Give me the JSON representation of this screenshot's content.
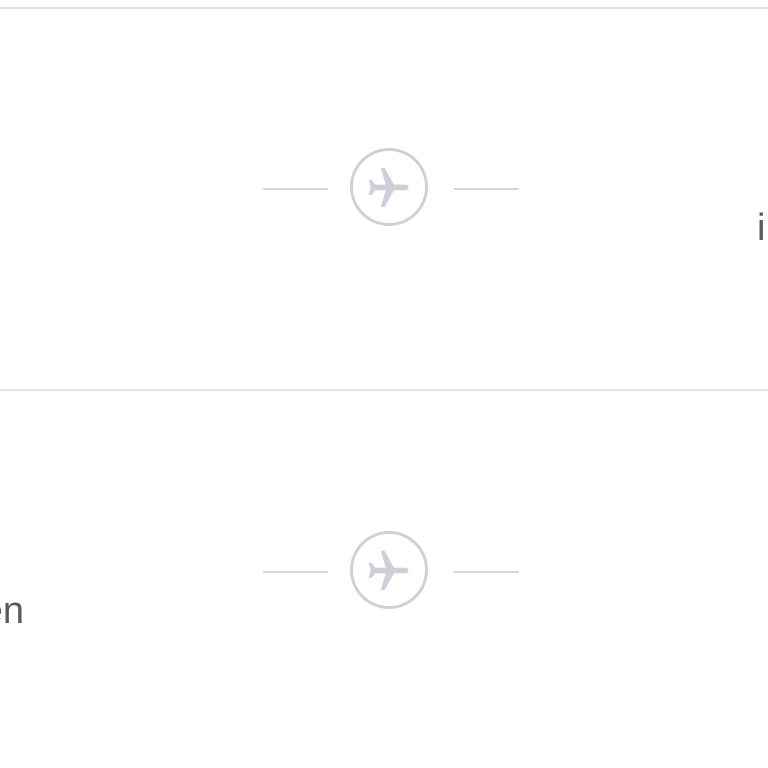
{
  "rows": [
    {
      "connector_icon": "airplane-icon",
      "right_text_fragment": "i"
    },
    {
      "connector_icon": "airplane-icon",
      "left_text_fragment": "en"
    }
  ],
  "colors": {
    "background": "#ffffff",
    "divider": "#e2e3e6",
    "connector_line": "#d4d6dc",
    "icon": "#cdd0d8",
    "text": "#555a63"
  }
}
